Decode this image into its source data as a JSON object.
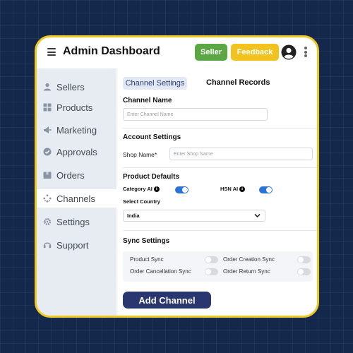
{
  "header": {
    "title": "Admin Dashboard",
    "seller_label": "Seller",
    "feedback_label": "Feedback",
    "colors": {
      "seller": "#5aa744",
      "feedback": "#f2c21e",
      "frame": "#f0c823"
    }
  },
  "sidebar": {
    "items": [
      {
        "label": "Sellers",
        "icon": "person-icon"
      },
      {
        "label": "Products",
        "icon": "grid-icon"
      },
      {
        "label": "Marketing",
        "icon": "megaphone-icon"
      },
      {
        "label": "Approvals",
        "icon": "check-circle-icon"
      },
      {
        "label": "Orders",
        "icon": "box-icon"
      },
      {
        "label": "Channels",
        "icon": "network-icon",
        "active": true
      },
      {
        "label": "Settings",
        "icon": "gear-icon"
      },
      {
        "label": "Support",
        "icon": "headset-icon"
      }
    ]
  },
  "tabs": {
    "active": "Channel Settings",
    "other": "Channel Records"
  },
  "form": {
    "channel_name_label": "Channel Name",
    "channel_name_placeholder": "Enter Channel Name",
    "account_settings_label": "Account Settings",
    "shop_name_label": "Shop Name*",
    "shop_name_placeholder": "Enter Shop Name",
    "product_defaults_label": "Product Defaults",
    "category_ai_label": "Category AI",
    "category_ai_on": true,
    "hsn_ai_label": "HSN AI",
    "hsn_ai_on": true,
    "select_country_label": "Select Country",
    "country_value": "India",
    "sync_settings_label": "Sync Settings",
    "sync": {
      "product_sync": "Product Sync",
      "order_creation_sync": "Order Creation Sync",
      "order_cancellation_sync": "Order Cancellation Sync",
      "order_return_sync": "Order Return Sync"
    },
    "add_channel_label": "Add Channel"
  },
  "accent_color": "#2a73d8",
  "primary_button_color": "#2a3670"
}
